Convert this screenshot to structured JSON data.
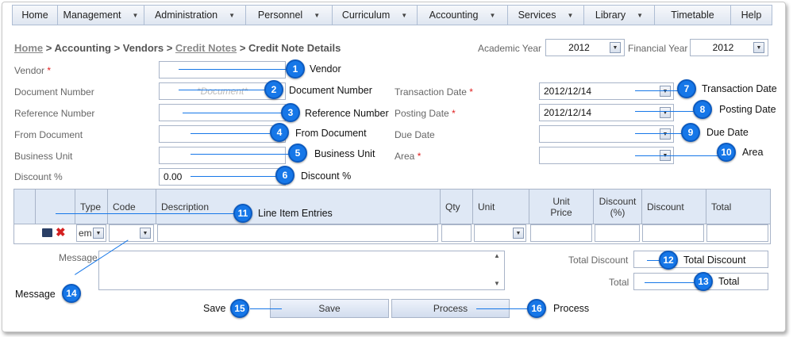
{
  "menu": [
    {
      "label": "Home",
      "caret": false
    },
    {
      "label": "Management",
      "caret": true
    },
    {
      "label": "Administration",
      "caret": true
    },
    {
      "label": "Personnel",
      "caret": true
    },
    {
      "label": "Curriculum",
      "caret": true
    },
    {
      "label": "Accounting",
      "caret": true
    },
    {
      "label": "Services",
      "caret": true
    },
    {
      "label": "Library",
      "caret": true
    },
    {
      "label": "Timetable",
      "caret": false
    },
    {
      "label": "Help",
      "caret": false
    }
  ],
  "breadcrumb": {
    "home": "Home",
    "sep": " > ",
    "accounting": "Accounting",
    "vendors": "Vendors",
    "credit_notes": "Credit Notes",
    "current": "Credit Note Details"
  },
  "academic_year": {
    "label": "Academic Year",
    "value": "2012"
  },
  "financial_year": {
    "label": "Financial Year",
    "value": "2012"
  },
  "form": {
    "vendor_label": "Vendor",
    "document_number_label": "Document Number",
    "document_number_placeholder": "*Document*",
    "reference_number_label": "Reference Number",
    "from_document_label": "From Document",
    "business_unit_label": "Business Unit",
    "discount_label": "Discount %",
    "discount_value": "0.00",
    "transaction_date_label": "Transaction Date",
    "transaction_date_value": "2012/12/14",
    "posting_date_label": "Posting Date",
    "posting_date_value": "2012/12/14",
    "due_date_label": "Due Date",
    "area_label": "Area",
    "required_mark": "*"
  },
  "grid": {
    "columns": [
      "Type",
      "Code",
      "Description",
      "Qty",
      "Unit",
      "Unit\nPrice",
      "Discount\n(%)",
      "Discount",
      "Total"
    ],
    "type_value": "em"
  },
  "message_label": "Message",
  "totals": {
    "total_discount_label": "Total Discount",
    "total_label": "Total"
  },
  "buttons": {
    "save": "Save",
    "process": "Process"
  },
  "callouts": [
    {
      "n": "1",
      "text": "Vendor"
    },
    {
      "n": "2",
      "text": "Document Number"
    },
    {
      "n": "3",
      "text": "Reference Number"
    },
    {
      "n": "4",
      "text": "From Document"
    },
    {
      "n": "5",
      "text": "Business Unit"
    },
    {
      "n": "6",
      "text": "Discount %"
    },
    {
      "n": "7",
      "text": "Transaction Date"
    },
    {
      "n": "8",
      "text": "Posting Date"
    },
    {
      "n": "9",
      "text": "Due Date"
    },
    {
      "n": "10",
      "text": "Area"
    },
    {
      "n": "11",
      "text": "Line Item Entries"
    },
    {
      "n": "12",
      "text": "Total Discount"
    },
    {
      "n": "13",
      "text": "Total"
    },
    {
      "n": "14",
      "text": "Message"
    },
    {
      "n": "15",
      "text": "Save"
    },
    {
      "n": "16",
      "text": "Process"
    }
  ],
  "colors": {
    "callout": "#1677e8",
    "menu_bg": "#e6ecf5",
    "border": "#a8b4c8",
    "required": "#e02020"
  }
}
